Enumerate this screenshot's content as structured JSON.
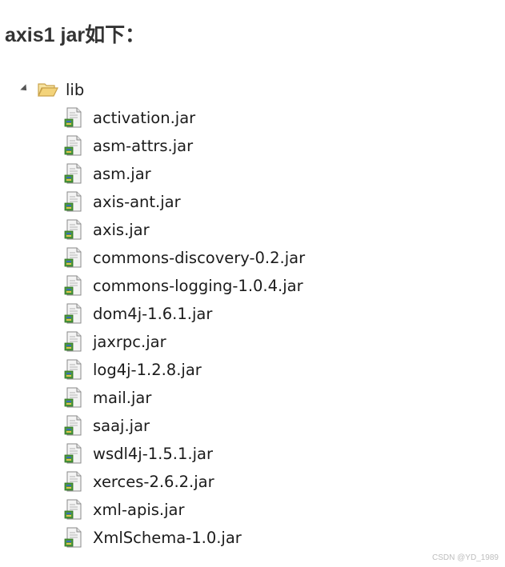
{
  "heading": "axis1 jar如下：",
  "tree": {
    "folder": {
      "label": "lib",
      "expanded": true,
      "icon": "open-folder-icon"
    },
    "files_icon": "jar-file-icon",
    "files": [
      "activation.jar",
      "asm-attrs.jar",
      "asm.jar",
      "axis-ant.jar",
      "axis.jar",
      "commons-discovery-0.2.jar",
      "commons-logging-1.0.4.jar",
      "dom4j-1.6.1.jar",
      "jaxrpc.jar",
      "log4j-1.2.8.jar",
      "mail.jar",
      "saaj.jar",
      "wsdl4j-1.5.1.jar",
      "xerces-2.6.2.jar",
      "xml-apis.jar",
      "XmlSchema-1.0.jar"
    ]
  },
  "watermark": "CSDN @YD_1989",
  "colors": {
    "heading_text": "#333333",
    "item_text": "#1b1b1b",
    "folder_fill": "#f3d37a",
    "folder_outline": "#c9a24a",
    "jar_paper": "#f4f4f4",
    "jar_green": "#4a9a3a",
    "jar_blue": "#3b6bb5",
    "watermark_text": "#bdbdbd"
  }
}
